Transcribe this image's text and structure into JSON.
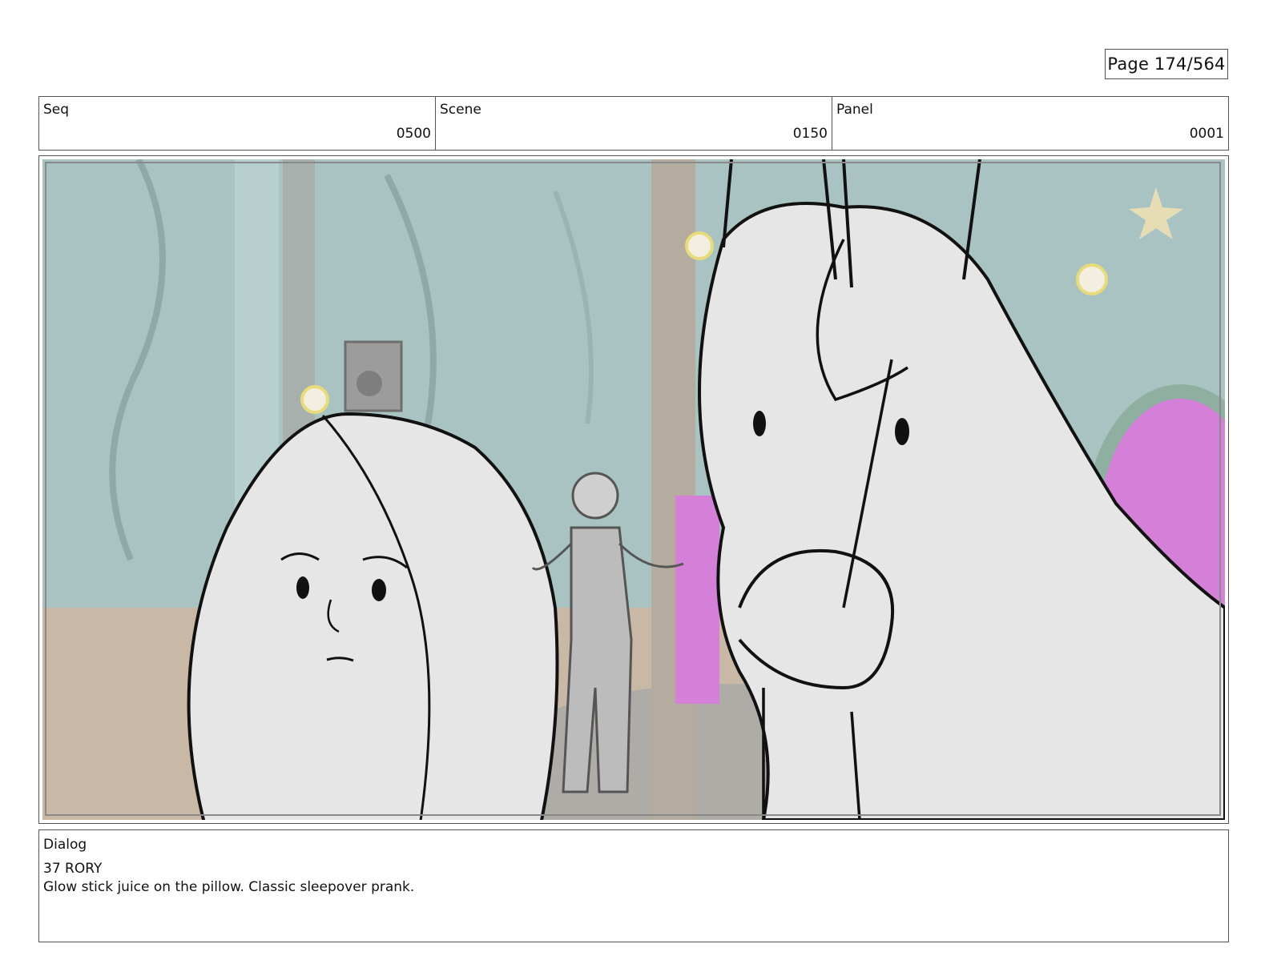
{
  "page": {
    "number_label": "Page 174/564"
  },
  "header": {
    "seq": {
      "label": "Seq",
      "value": "0500"
    },
    "scene": {
      "label": "Scene",
      "value": "0150"
    },
    "panel": {
      "label": "Panel",
      "value": "0001"
    }
  },
  "dialog": {
    "label": "Dialog",
    "speaker": "37 RORY",
    "line": "Glow stick juice on the pillow. Classic sleepover prank."
  },
  "colors": {
    "border": "#555555",
    "background_teal": "#a9c3c3",
    "floor_tan": "#c9b8a5",
    "accent_magenta": "#d47fd8",
    "accent_yellow": "#e8dc7a",
    "sketch_fill": "#e6e6e6"
  }
}
